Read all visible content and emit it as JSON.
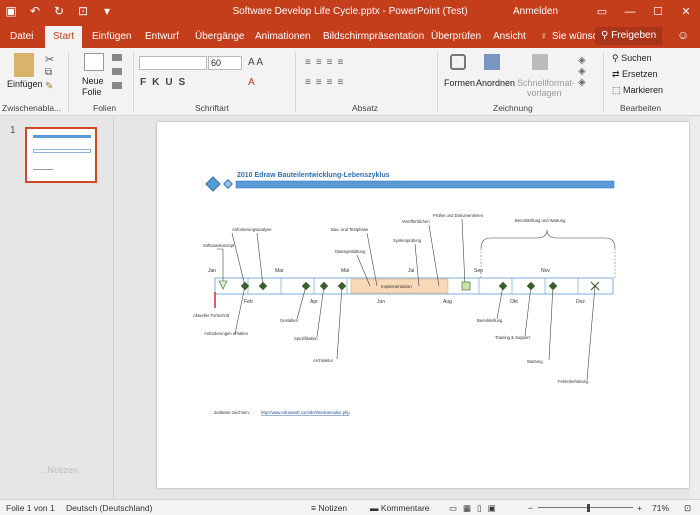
{
  "window": {
    "title": "Software Develop Life Cycle.pptx  -  PowerPoint (Test)",
    "signin": "Anmelden"
  },
  "tabs": [
    "Datei",
    "Start",
    "Einfügen",
    "Entwurf",
    "Übergänge",
    "Animationen",
    "Bildschirmpräsentation",
    "Überprüfen",
    "Ansicht"
  ],
  "search_hint": "Sie wünsc",
  "share": "Freigeben",
  "ribbon": {
    "paste": "Einfügen",
    "new_slide": "Neue",
    "new_slide2": "Folie",
    "font_size": "60",
    "shapes": "Formen",
    "arrange": "Anordnen",
    "quick_styles": "Schnellformat-",
    "quick_styles2": "vorlagen",
    "find": "Suchen",
    "replace": "Ersetzen",
    "select": "Markieren",
    "groups": [
      "Zwischenabla...",
      "Folien",
      "Schriftart",
      "Absatz",
      "Zeichnung",
      "Bearbeiten"
    ]
  },
  "slide_number": "1",
  "notes_hint": "...Notizen",
  "slide": {
    "title": "2010 Edraw Bauteilentwicklung-Lebenszyklus",
    "months_top": [
      "Jan",
      "Mar",
      "Mai",
      "Jul",
      "Sep",
      "Nov"
    ],
    "months_bottom": [
      "Feb",
      "Apr",
      "Jun",
      "Aug",
      "Okt",
      "Dez"
    ],
    "labels_top": [
      "Softwarekonzept",
      "Anforderungsanalyse",
      "Datengestaltung",
      "Bau- und Testphase",
      "Systemprüfung",
      "Veröffentlichen",
      "Prüfen und Dokumentieren",
      "Bereitstellung und Wartung"
    ],
    "labels_bottom": [
      "Aktueller Fortschritt",
      "Anforderungen erhalten",
      "Gestalten",
      "Spezifikation",
      "Architektur",
      "Bereitstellung",
      "Training & Support",
      "Wartung",
      "Fehlerbehebung"
    ],
    "phase": "Implementation",
    "footer_prefix": "Zeitleiste zeichnen:",
    "footer_link": "http://www.edrawsoft.com/de/timelinemaker.php"
  },
  "status": {
    "slide": "Folie 1 von 1",
    "language": "Deutsch (Deutschland)",
    "notes": "Notizen",
    "comments": "Kommentare",
    "zoom": "71%"
  },
  "colors": {
    "accent": "#c43e1c",
    "diamond": "#3b5e2b",
    "title": "#2f6fb7"
  }
}
